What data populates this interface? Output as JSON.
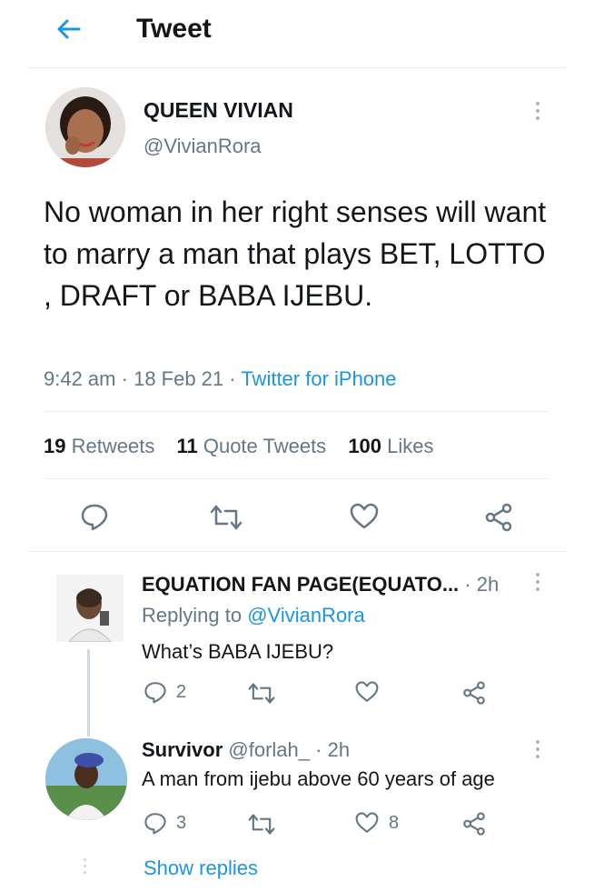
{
  "header": {
    "title": "Tweet"
  },
  "tweet": {
    "display_name": "QUEEN VIVIAN",
    "handle": "@VivianRora",
    "text": "No woman in her right senses will want to marry a man that plays BET, LOTTO , DRAFT or BABA IJEBU.",
    "time": "9:42 am",
    "date": "18 Feb 21",
    "source": "Twitter for iPhone",
    "stats": {
      "retweets_count": "19",
      "retweets_label": "Retweets",
      "quotes_count": "11",
      "quotes_label": "Quote Tweets",
      "likes_count": "100",
      "likes_label": "Likes"
    }
  },
  "replies": [
    {
      "display_name": "EQUATION FAN PAGE(EQUATO...",
      "time": "2h",
      "replying_prefix": "Replying to",
      "replying_handle": "@VivianRora",
      "text": "What’s BABA IJEBU?",
      "reply_count": "2",
      "retweet_count": "",
      "like_count": ""
    },
    {
      "display_name": "Survivor",
      "handle": "@forlah_",
      "time": "2h",
      "text": "A man from ijebu above 60 years of age",
      "reply_count": "3",
      "retweet_count": "",
      "like_count": "8"
    }
  ],
  "show_replies_label": "Show replies",
  "colors": {
    "accent": "#1b95e0",
    "text": "#14171a",
    "muted": "#657786",
    "divider": "#e6ecf0"
  }
}
